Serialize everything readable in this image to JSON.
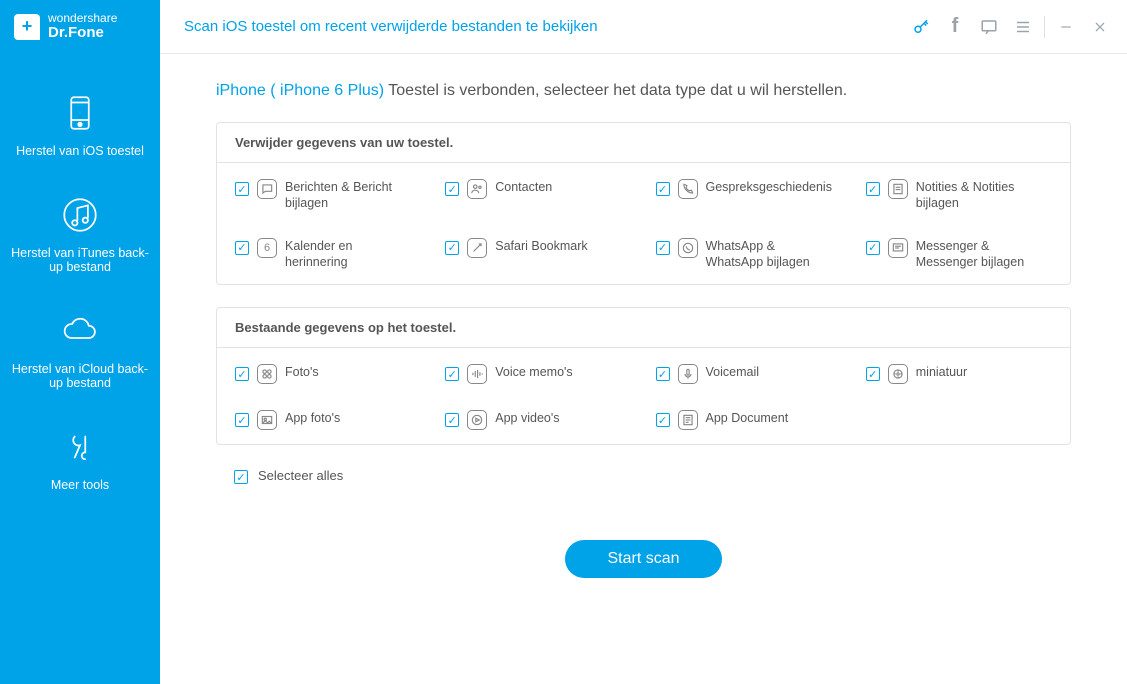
{
  "app": {
    "brand_top": "wondershare",
    "brand_main": "Dr.Fone"
  },
  "title": "Scan iOS toestel om recent verwijderde bestanden te bekijken",
  "sidebar": {
    "items": [
      {
        "label": "Herstel van iOS toestel"
      },
      {
        "label": "Herstel van iTunes back-up bestand"
      },
      {
        "label": "Herstel van iCloud back-up bestand"
      },
      {
        "label": "Meer tools"
      }
    ]
  },
  "heading": {
    "device": "iPhone ( iPhone 6 Plus)",
    "rest": " Toestel is verbonden, selecteer het data type dat u wil herstellen."
  },
  "panels": [
    {
      "title": "Verwijder gegevens van uw toestel.",
      "items": [
        {
          "label": "Berichten & Bericht bijlagen"
        },
        {
          "label": "Contacten"
        },
        {
          "label": "Gespreksgeschiedenis"
        },
        {
          "label": "Notities & Notities bijlagen"
        },
        {
          "label": "Kalender en herinnering"
        },
        {
          "label": "Safari Bookmark"
        },
        {
          "label": "WhatsApp & WhatsApp bijlagen"
        },
        {
          "label": "Messenger & Messenger bijlagen"
        }
      ]
    },
    {
      "title": "Bestaande gegevens op het toestel.",
      "items": [
        {
          "label": "Foto's"
        },
        {
          "label": "Voice memo's"
        },
        {
          "label": "Voicemail"
        },
        {
          "label": "miniatuur"
        },
        {
          "label": "App foto's"
        },
        {
          "label": "App video's"
        },
        {
          "label": "App Document"
        }
      ]
    }
  ],
  "select_all": "Selecteer alles",
  "scan_button": "Start scan"
}
